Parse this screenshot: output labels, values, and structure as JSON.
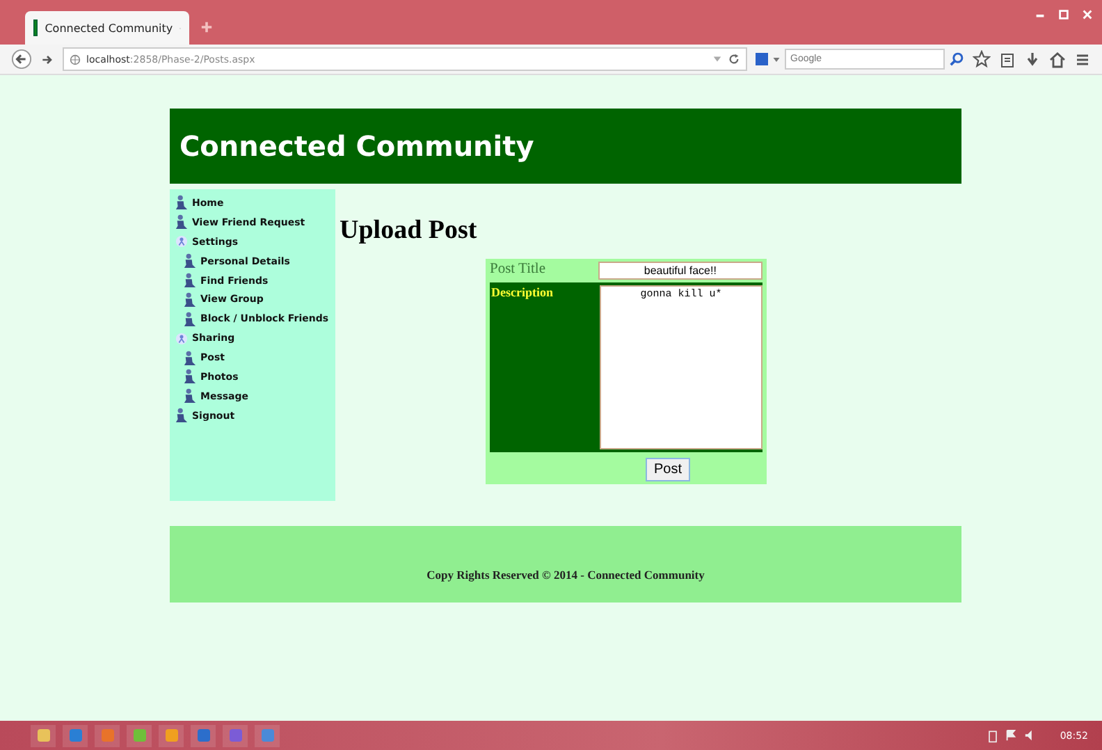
{
  "browser": {
    "tab_title": "Connected Community",
    "url_host": "localhost",
    "url_path": ":2858/Phase-2/Posts.aspx",
    "search_placeholder": "Google"
  },
  "header": {
    "title": "Connected Community"
  },
  "sidebar": {
    "items": [
      {
        "label": "Home",
        "kind": "page"
      },
      {
        "label": "View Friend Request",
        "kind": "page"
      },
      {
        "label": "Settings",
        "kind": "group",
        "children": [
          {
            "label": "Personal Details",
            "kind": "page"
          },
          {
            "label": "Find Friends",
            "kind": "page"
          },
          {
            "label": "View Group",
            "kind": "page"
          },
          {
            "label": "Block / Unblock Friends",
            "kind": "page"
          }
        ]
      },
      {
        "label": "Sharing",
        "kind": "group",
        "children": [
          {
            "label": "Post",
            "kind": "page"
          },
          {
            "label": "Photos",
            "kind": "page"
          },
          {
            "label": "Message",
            "kind": "page"
          }
        ]
      },
      {
        "label": "Signout",
        "kind": "page"
      }
    ]
  },
  "main": {
    "heading": "Upload Post",
    "form": {
      "title_label": "Post Title",
      "title_value": "beautiful face!!",
      "description_label": "Description",
      "description_value": "gonna kill u*",
      "submit": "Post"
    }
  },
  "footer": {
    "text": "Copy Rights Reserved © 2014 - Connected Community"
  },
  "taskbar": {
    "clock": "08:52"
  }
}
